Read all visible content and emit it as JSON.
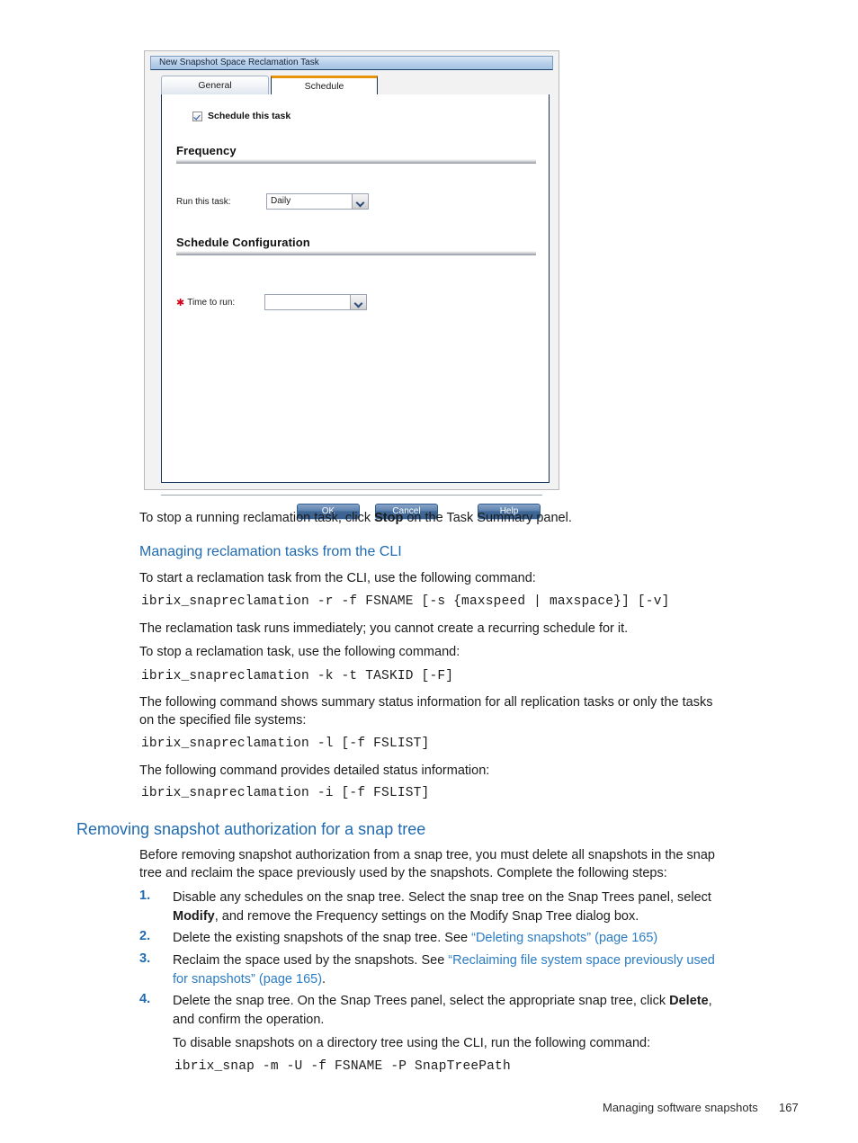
{
  "dialog": {
    "title": "New Snapshot Space Reclamation Task",
    "tabs": [
      {
        "label": "General",
        "active": false
      },
      {
        "label": "Schedule",
        "active": true
      }
    ],
    "checkbox": {
      "label": "Schedule this task",
      "checked": true
    },
    "sections": [
      {
        "title": "Frequency"
      },
      {
        "title": "Schedule Configuration"
      }
    ],
    "fields": [
      {
        "label": "Run this task:",
        "value": "Daily",
        "required": false
      },
      {
        "label": "Time to run:",
        "value": "",
        "required": true
      }
    ],
    "buttons": [
      {
        "label": "OK"
      },
      {
        "label": "Cancel"
      },
      {
        "label": "Help"
      }
    ]
  },
  "body": {
    "p_stop_running": {
      "before": "To stop a running reclamation task, click ",
      "bold": "Stop",
      "after": " on the Task Summary panel."
    },
    "h2_cli": "Managing reclamation tasks from the CLI",
    "p_start": "To start a reclamation task from the CLI, use the following command:",
    "code_start": "ibrix_snapreclamation -r -f FSNAME [-s {maxspeed | maxspace}] [-v]",
    "p_immediate": "The reclamation task runs immediately; you cannot create a recurring schedule for it.",
    "p_stop_task": "To stop a reclamation task, use the following command:",
    "code_stop": "ibrix_snapreclamation -k -t TASKID [-F]",
    "p_summary_l1": "The following command shows summary status information for all replication tasks or only the tasks",
    "p_summary_l2": "on the specified file systems:",
    "code_list": "ibrix_snapreclamation -l [-f FSLIST]",
    "p_detail": "The following command provides detailed status information:",
    "code_info": "ibrix_snapreclamation -i [-f FSLIST]",
    "h1_removing": "Removing snapshot authorization for a snap tree",
    "p_before_l1": "Before removing snapshot authorization from a snap tree, you must delete all snapshots in the snap",
    "p_before_l2": "tree and reclaim the space previously used by the snapshots. Complete the following steps:",
    "steps": [
      {
        "num": "1.",
        "l1_a": "Disable any schedules on the snap tree. Select the snap tree on the Snap Trees panel, select",
        "l2_bold": "Modify",
        "l2_rest": ", and remove the Frequency settings on the Modify Snap Tree dialog box."
      },
      {
        "num": "2.",
        "l1_a": "Delete the existing snapshots of the snap tree. See ",
        "l1_link": "“Deleting snapshots” (page 165)"
      },
      {
        "num": "3.",
        "l1_a": "Reclaim the space used by the snapshots. See ",
        "l1_link": "“Reclaiming file system space previously used",
        "l2_link": "for snapshots” (page 165)",
        "l2_rest": "."
      },
      {
        "num": "4.",
        "l1_a": "Delete the snap tree. On the Snap Trees panel, select the appropriate snap tree, click ",
        "l1_bold": "Delete",
        "l1_after": ",",
        "l2_rest": "and confirm the operation."
      }
    ],
    "p_disable_cli": "To disable snapshots on a directory tree using the CLI, run the following command:",
    "code_snap": "ibrix_snap -m -U -f FSNAME -P SnapTreePath"
  },
  "footer": {
    "chapter": "Managing software snapshots",
    "page": "167"
  },
  "colors": {
    "heading_blue": "#1f6ab0",
    "link_blue": "#2b7cc4",
    "tab_active_accent": "#e8930c",
    "required_red": "#d0021b"
  }
}
